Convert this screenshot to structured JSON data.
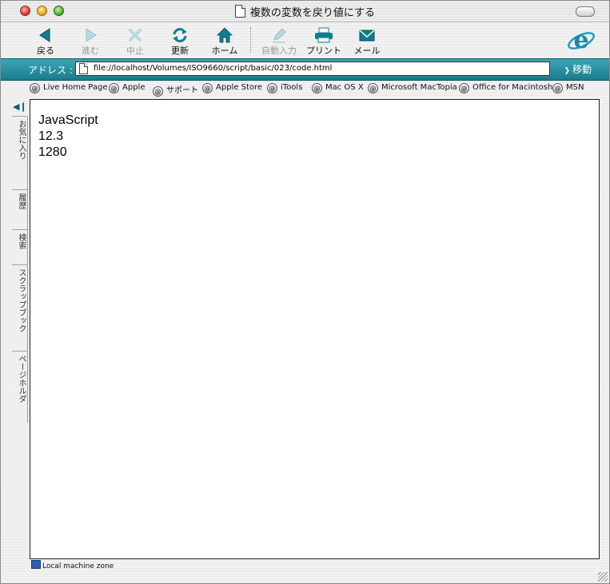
{
  "window": {
    "title": "複数の変数を戻り値にする"
  },
  "toolbar": {
    "back": "戻る",
    "forward": "進む",
    "stop": "中止",
    "refresh": "更新",
    "home": "ホーム",
    "autofill": "自動入力",
    "print": "プリント",
    "mail": "メール",
    "icons": {
      "back": "back-arrow-icon",
      "forward": "forward-arrow-icon",
      "stop": "stop-x-icon",
      "refresh": "refresh-arrows-icon",
      "home": "home-icon",
      "autofill": "autofill-pen-icon",
      "print": "printer-icon",
      "mail": "envelope-icon",
      "browser": "internet-explorer-logo"
    }
  },
  "address": {
    "label": "アドレス :",
    "url": "file://localhost/Volumes/ISO9660/script/basic/023/code.html",
    "go_label": "移動"
  },
  "favorites": [
    "Live Home Page",
    "Apple",
    "サポート",
    "Apple Store",
    "iTools",
    "Mac OS X",
    "Microsoft MacTopia",
    "Office for Macintosh",
    "MSN"
  ],
  "sidebar_tabs": [
    "お気に入り",
    "履歴",
    "検索",
    "スクラップブック",
    "ページホルダ"
  ],
  "page": {
    "lines": [
      "JavaScript",
      "12.3",
      "1280"
    ]
  },
  "status": {
    "text": "Local machine zone"
  },
  "colors": {
    "accent": "#1a7c8c",
    "icon_teal": "#0f7f90"
  }
}
